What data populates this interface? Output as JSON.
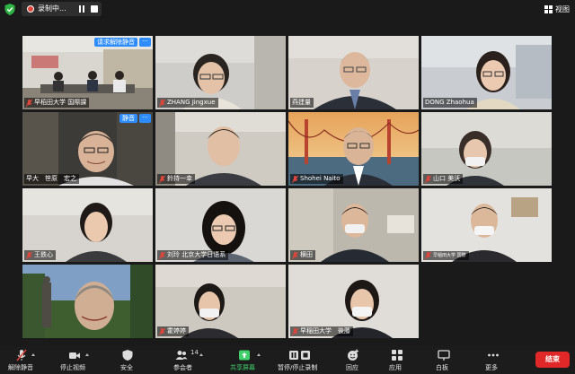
{
  "recording": {
    "label": "录制中..."
  },
  "view": {
    "label": "视图"
  },
  "tiles": [
    {
      "name": "早稻田大学 国際課",
      "pill": "请求解除静音"
    },
    {
      "name": "ZHANG Jingxue"
    },
    {
      "name": "燕建量"
    },
    {
      "name": "DONG Zhaohua"
    },
    {
      "name": "早大　笹原　宏之",
      "pill": "静音"
    },
    {
      "name": "鈴持一幸"
    },
    {
      "name": "Shohei Naito"
    },
    {
      "name": "山口 美沃"
    },
    {
      "name": "王鉄心"
    },
    {
      "name": "刘玲 北京大学日语系"
    },
    {
      "name": "横田"
    },
    {
      "name": "早稲田大学 国際"
    },
    {
      "name": ""
    },
    {
      "name": "霍婷婷"
    },
    {
      "name": "早稲田大学　後藤"
    }
  ],
  "toolbar": {
    "unmute": "解除静音",
    "stop_video": "停止视频",
    "security": "安全",
    "participants": "参会者",
    "participants_count": "14",
    "share": "共享屏幕",
    "pause_record": "暂停/停止录制",
    "reactions": "回应",
    "apps": "应用",
    "whiteboard": "白板",
    "more": "更多",
    "end": "结束"
  },
  "colors": {
    "active_speaker": "#c9e06a",
    "accent": "#2d8cff",
    "end": "#e02828",
    "share": "#3fd06b"
  }
}
